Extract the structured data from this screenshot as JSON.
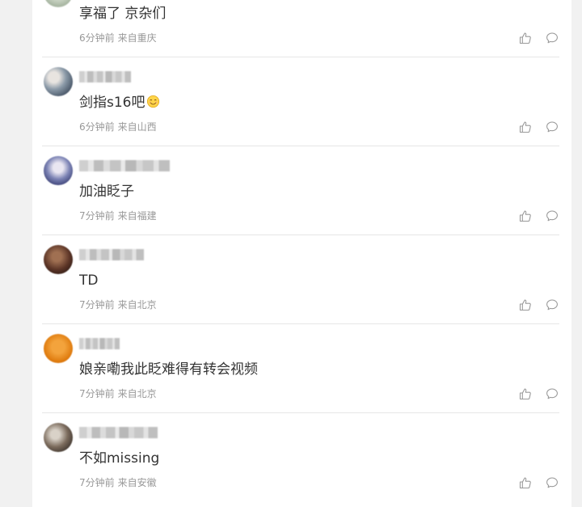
{
  "comments": [
    {
      "text": "享福了 京杂们",
      "time": "6分钟前",
      "location": "来自重庆"
    },
    {
      "text": "剑指s16吧",
      "emoji_icon": "smiling-face-emoji",
      "time": "6分钟前",
      "location": "来自山西"
    },
    {
      "text": "加油眨子",
      "time": "7分钟前",
      "location": "来自福建"
    },
    {
      "text": "TD",
      "time": "7分钟前",
      "location": "来自北京"
    },
    {
      "text": "娘亲嘞我此眨难得有转会视频",
      "time": "7分钟前",
      "location": "来自北京"
    },
    {
      "text": "不如missing",
      "time": "7分钟前",
      "location": "来自安徽"
    }
  ],
  "icons": {
    "like": "thumbs-up-icon",
    "reply": "comment-icon",
    "emoji": "smiling-face-emoji"
  },
  "colors": {
    "text": "#333333",
    "meta": "#999999",
    "icon": "#9a9a9a",
    "divider": "#e6e6e6",
    "background": "#f1f1f1",
    "panel": "#ffffff"
  }
}
